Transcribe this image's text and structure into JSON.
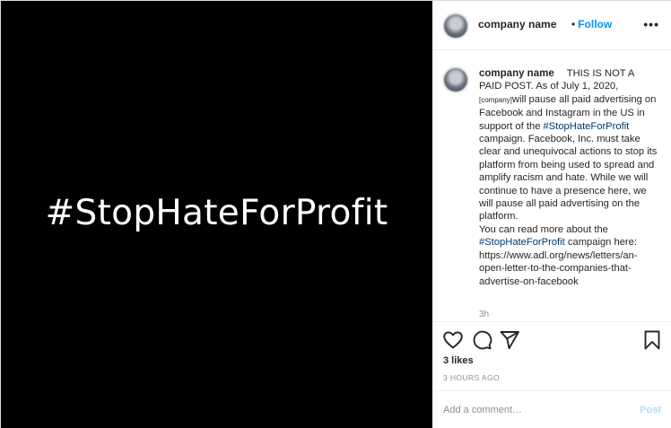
{
  "media": {
    "text": "#StopHateForProfit"
  },
  "header": {
    "username": "company name",
    "follow_separator": "•",
    "follow_label": "Follow",
    "more_label": "•••"
  },
  "caption": {
    "username": "company name",
    "intro": "THIS IS NOT A PAID POST. As of July 1, 2020,",
    "company_placeholder": "[company]",
    "after_company": "will pause all paid advertising on Facebook and Instagram in the US in support of the",
    "hashtag_1": "#StopHateForProfit",
    "after_hashtag_1": "campaign. Facebook, Inc. must take clear and unequivocal actions to stop its platform from being used to spread and amplify racism and hate. While we will continue to have a presence here, we will pause all paid advertising on the platform.",
    "read_more_prefix": "You can read more about the",
    "hashtag_2": "#StopHateForProfit",
    "read_more_suffix": "campaign here:",
    "url": "https://www.adl.org/news/letters/an-open-letter-to-the-companies-that-advertise-on-facebook",
    "timestamp": "3h"
  },
  "actions": {
    "like_icon": "heart-icon",
    "comment_icon": "comment-bubble-icon",
    "share_icon": "paper-plane-icon",
    "save_icon": "bookmark-icon"
  },
  "likes": "3 likes",
  "time_ago": "3 HOURS AGO",
  "comment": {
    "placeholder": "Add a comment…",
    "value": "",
    "post_label": "Post"
  },
  "colors": {
    "link_blue": "#0095f6",
    "hashtag": "#00376b",
    "post_disabled": "#b2dffc",
    "media_background": "#000000"
  }
}
